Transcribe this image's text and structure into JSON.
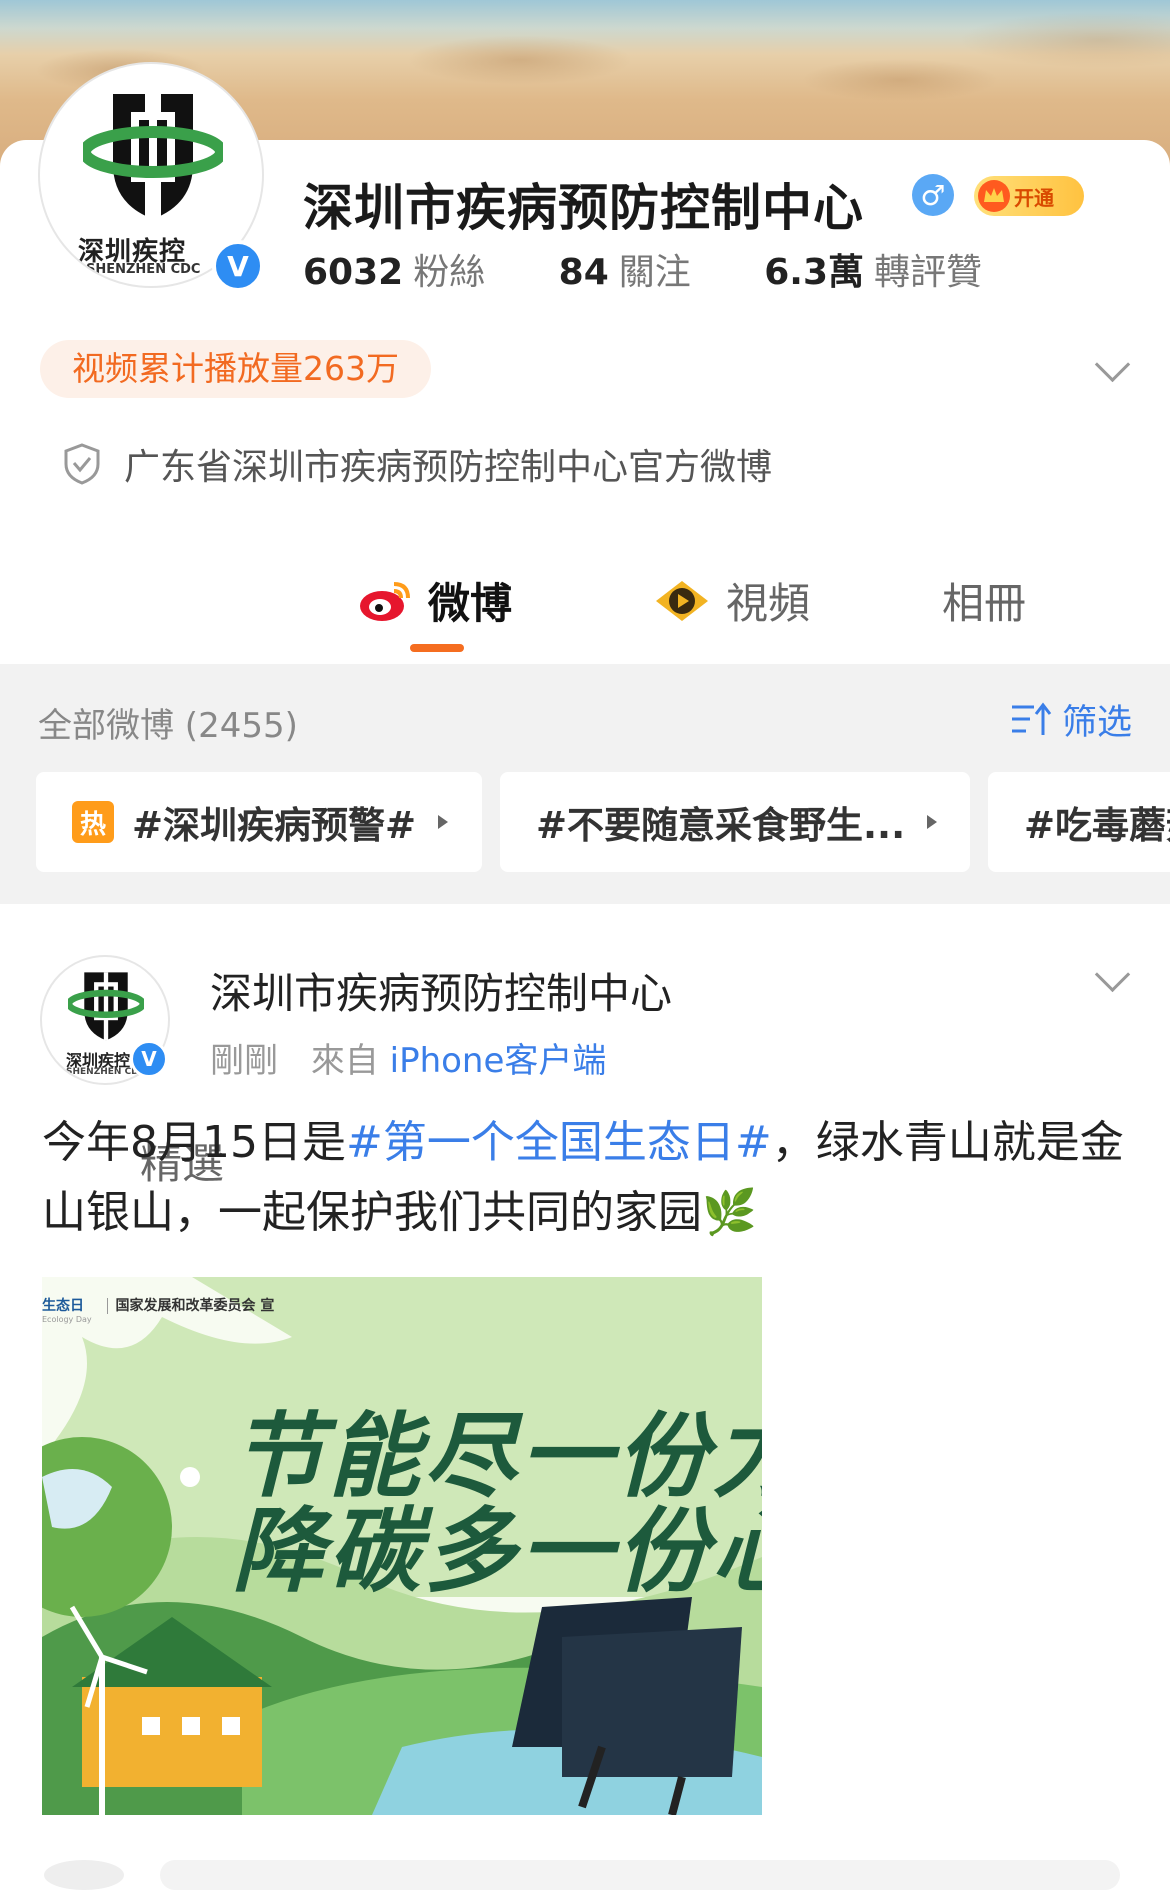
{
  "profile": {
    "name": "深圳市疾病预防控制中心",
    "avatar_text_cn": "深圳疾控",
    "avatar_text_en": "SHENZHEN CDC",
    "verified_mark": "V",
    "gender_symbol": "♂",
    "vip_label": "开通",
    "stats": [
      {
        "value": "6032",
        "label": "粉絲"
      },
      {
        "value": "84",
        "label": "關注"
      },
      {
        "value": "6.3萬",
        "label": "轉評贊"
      }
    ],
    "video_tag": "视频累计播放量263万",
    "description": "广东省深圳市疾病预防控制中心官方微博"
  },
  "tabs": [
    {
      "label": "精選",
      "active": false
    },
    {
      "label": "微博",
      "active": true
    },
    {
      "label": "視頻",
      "active": false
    },
    {
      "label": "相冊",
      "active": false
    }
  ],
  "filter": {
    "count_label": "全部微博 (2455)",
    "filter_button": "筛选",
    "chips": [
      {
        "badge": "热",
        "text": "#深圳疾病预警#"
      },
      {
        "text": "#不要随意采食野生..."
      },
      {
        "text": "#吃毒蘑菇"
      }
    ]
  },
  "post": {
    "author": "深圳市疾病预防控制中心",
    "time": "剛剛",
    "source_prefix": "來自",
    "source": "iPhone客户端",
    "text_before": "今年8月15日是",
    "hashtag": "#第一个全国生态日#",
    "text_after": "，绿水青山就是金山银山，一起保护我们共同的家园",
    "emoji": "🌿",
    "image": {
      "header_left": "生态日",
      "header_left_small": "Ecology Day",
      "header_right": "国家发展和改革委员会 宣",
      "headline_1": "节能尽一份力",
      "headline_2": "降碳多一份心"
    }
  },
  "colors": {
    "accent_orange": "#f56d20",
    "link_blue": "#3a7ee8",
    "verified_blue": "#2e8df3",
    "logo_green": "#3aa04a"
  }
}
